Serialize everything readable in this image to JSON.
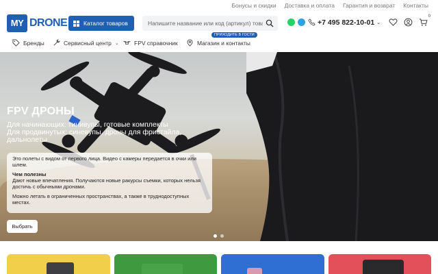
{
  "topbar": {
    "links": [
      "Бонусы и скидки",
      "Доставка и оплата",
      "Гарантия и возврат",
      "Контакты"
    ]
  },
  "header": {
    "logo_box": "MY",
    "logo_text": "DRONE",
    "catalog_label": "Каталог товаров",
    "search_placeholder": "Напишите название или код (артикул) товара",
    "phone": "+7 495 822-10-01",
    "cart_count": "0"
  },
  "nav": {
    "items": [
      {
        "label": "Бренды",
        "icon": "tag-icon"
      },
      {
        "label": "Сервисный центр",
        "icon": "wrench-icon"
      },
      {
        "label": "FPV справочник",
        "icon": "drone-icon"
      },
      {
        "label": "Магазин и контакты",
        "icon": "location-icon"
      }
    ],
    "guest_badge": "ПРИХОДИТЕ В ГОСТИ"
  },
  "hero": {
    "title": "FPV ДРОНЫ",
    "subtitle_1": "Для начинающих: тинивупы, готовые комплекты",
    "subtitle_2": "Для продвинутых: синевупы, дроны для фристайла, дальнолеты",
    "card_intro": "Это полеты с видом от первого лица. Видео с камеры передается в очки или шлем.",
    "card_heading": "Чем полезны",
    "card_body": "Дают новые впечатления. Получаются новые ракурсы съемки, которых нельзя достичь с обычными дронами.",
    "card_footer": "Можно летать в ограниченных пространствах, а также в труднодоступных местах.",
    "button": "Выбрать"
  },
  "colors": {
    "brand": "#1f5fb4",
    "tile_1": "#f2cf4a",
    "tile_2": "#3f9a3f",
    "tile_3": "#2f6fd4",
    "tile_4": "#e4505a"
  }
}
